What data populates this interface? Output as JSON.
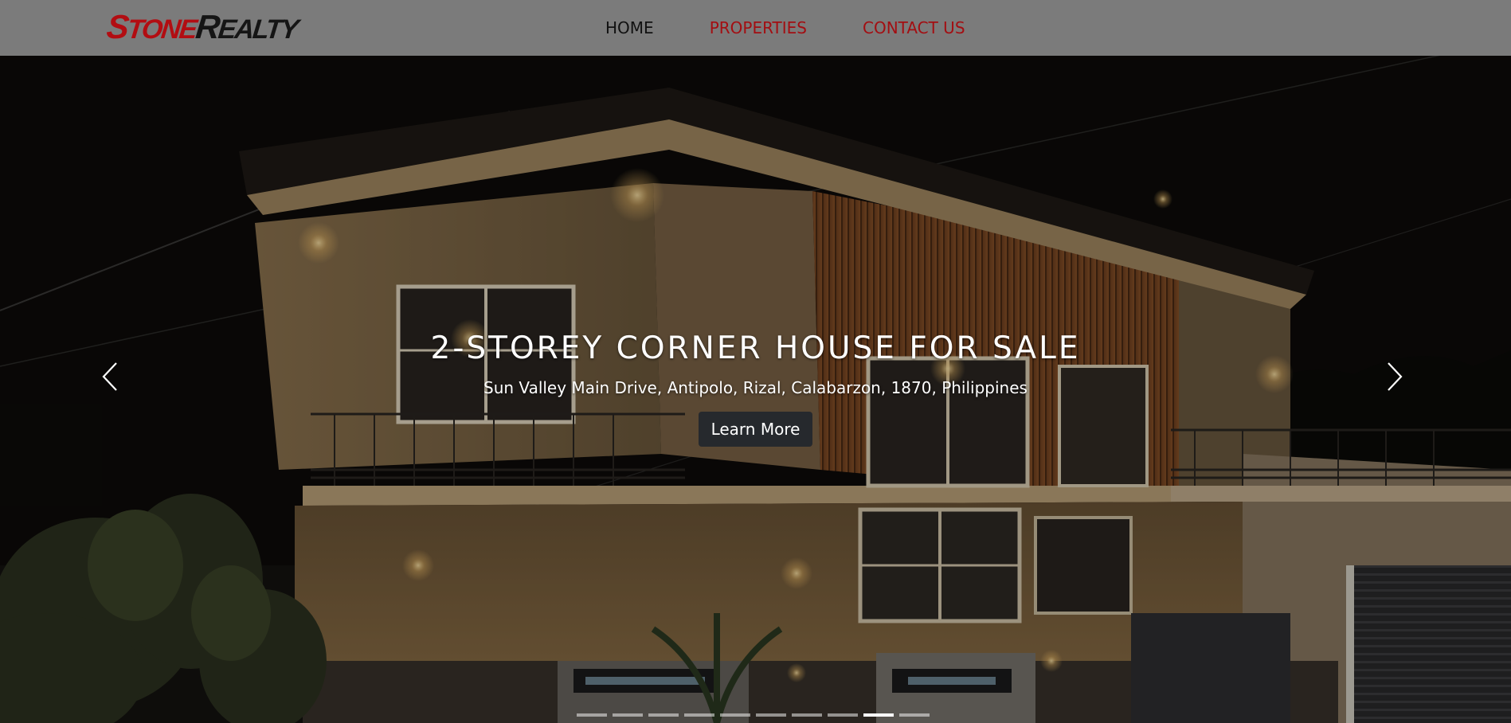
{
  "brand": {
    "name_part1": "Stone",
    "name_part2": "Realty",
    "colors": {
      "accent": "#b20d12",
      "dark": "#151515"
    }
  },
  "nav": {
    "items": [
      {
        "label": "HOME",
        "active": true
      },
      {
        "label": "PROPERTIES",
        "active": false
      },
      {
        "label": "CONTACT US",
        "active": false
      }
    ]
  },
  "hero": {
    "title": "2-STOREY CORNER HOUSE FOR SALE",
    "address": "Sun Valley Main Drive, Antipolo, Rizal, Calabarzon, 1870, Philippines",
    "button_label": "Learn More",
    "prev_icon": "chevron-left-icon",
    "next_icon": "chevron-right-icon",
    "slide_count": 10,
    "active_slide": 9
  }
}
